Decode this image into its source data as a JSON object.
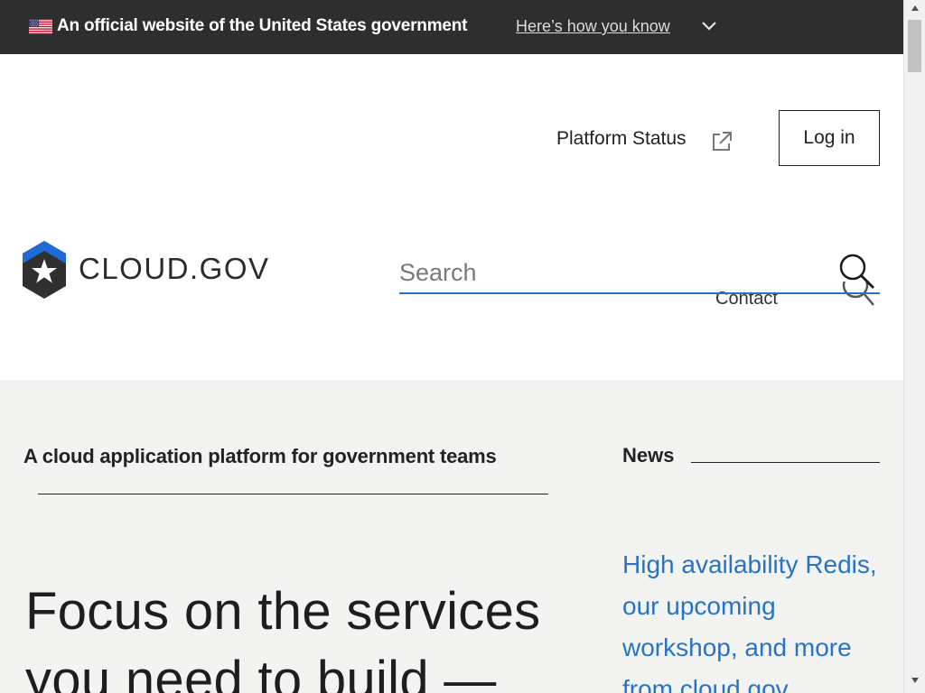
{
  "banner": {
    "official_text": "An official website of the United States government",
    "how_you_know": "Here’s how you know"
  },
  "header": {
    "platform_status": "Platform Status",
    "login": "Log in",
    "logo_text": "CLOUD.GOV",
    "contact": "Contact"
  },
  "search": {
    "placeholder": "Search",
    "value": ""
  },
  "main": {
    "tagline": "A cloud application platform for government teams",
    "heading": "Focus on the services you need to build —",
    "news_label": "News",
    "news_link": "High availability Redis, our upcoming workshop, and more from cloud.gov"
  },
  "colors": {
    "banner_bg": "#2e2e2e",
    "link_blue": "#2774c7",
    "section_gray": "#f3f3f2",
    "logo_blue": "#1e6bd6",
    "logo_dark": "#303030"
  },
  "icons": {
    "flag": "us-flag-icon",
    "chevron": "chevron-down-icon",
    "external": "external-link-icon",
    "search": "search-icon",
    "logo": "cloud-gov-logo"
  }
}
